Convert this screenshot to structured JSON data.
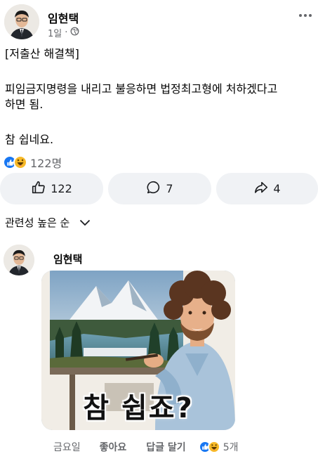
{
  "post": {
    "author": "임현택",
    "time": "1일",
    "separator": "·",
    "privacy_icon": "globe-icon",
    "more_icon": "more-horizontal-icon",
    "body_lines": [
      "[저출산 해결책]",
      "피임금지명령을 내리고 불응하면 법정최고형에 처하겠다고",
      "하면  됨.",
      "참 쉽네요."
    ],
    "reactions": {
      "icons": [
        "like-reaction-icon",
        "haha-reaction-icon"
      ],
      "count": "122명"
    },
    "actions": {
      "like_count": "122",
      "comment_count": "7",
      "share_count": "4"
    }
  },
  "sort": {
    "label": "관련성 높은 순"
  },
  "comment": {
    "author": "임현택",
    "image_caption": "참 쉽죠?",
    "time": "금요일",
    "like_label": "좋아요",
    "reply_label": "답글 달기",
    "reaction_count": "5개"
  },
  "colors": {
    "accent": "#1877f2",
    "muted": "#65676b",
    "button_bg": "#f0f2f5",
    "haha": "#f7b928"
  }
}
